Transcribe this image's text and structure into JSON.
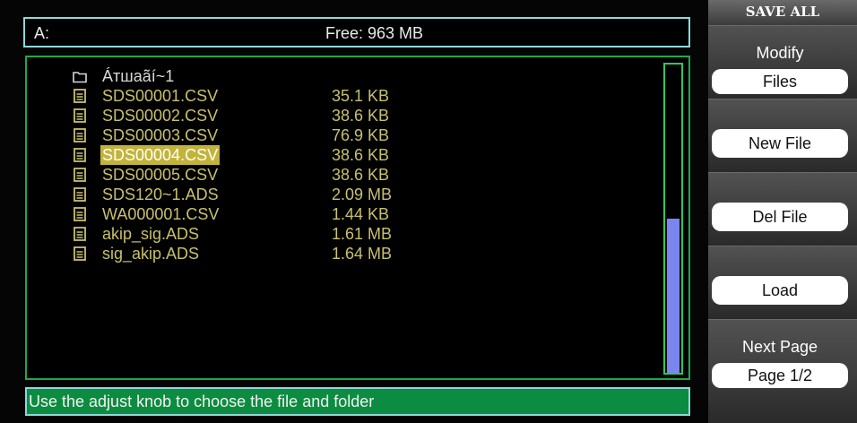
{
  "path_bar": {
    "drive": "A:",
    "free_space": "Free: 963 MB"
  },
  "files": [
    {
      "type": "folder",
      "name": "Áтшaãí~1",
      "size": ""
    },
    {
      "type": "file",
      "name": "SDS00001.CSV",
      "size": "35.1 KB"
    },
    {
      "type": "file",
      "name": "SDS00002.CSV",
      "size": "38.6 KB"
    },
    {
      "type": "file",
      "name": "SDS00003.CSV",
      "size": "76.9 KB"
    },
    {
      "type": "file",
      "name": "SDS00004.CSV",
      "size": "38.6 KB",
      "selected": true
    },
    {
      "type": "file",
      "name": "SDS00005.CSV",
      "size": "38.6 KB"
    },
    {
      "type": "file",
      "name": "SDS120~1.ADS",
      "size": "2.09 MB"
    },
    {
      "type": "file",
      "name": "WA000001.CSV",
      "size": "1.44 KB"
    },
    {
      "type": "file",
      "name": "akip_sig.ADS",
      "size": "1.61 MB"
    },
    {
      "type": "file",
      "name": "sig_akip.ADS",
      "size": "1.64 MB"
    }
  ],
  "scrollbar": {
    "thumb_start_fraction": 0.5,
    "thumb_end_fraction": 1.0
  },
  "status_message": "Use the adjust knob to choose the file and folder",
  "menu": {
    "title": "SAVE ALL",
    "modify_label": "Modify",
    "modify_value": "Files",
    "new_file": "New File",
    "del_file": "Del File",
    "load": "Load",
    "next_page_label": "Next Page",
    "next_page_value": "Page 1/2"
  },
  "colors": {
    "file_text": "#c8c06e",
    "selection": "#c2b43a",
    "status_bg": "#0c8c40",
    "scroll_thumb": "#7a85f0",
    "frame_cyan": "#8fd8d8",
    "frame_green": "#1ea84c"
  },
  "icons": {
    "folder": "folder-icon",
    "file": "file-icon"
  }
}
